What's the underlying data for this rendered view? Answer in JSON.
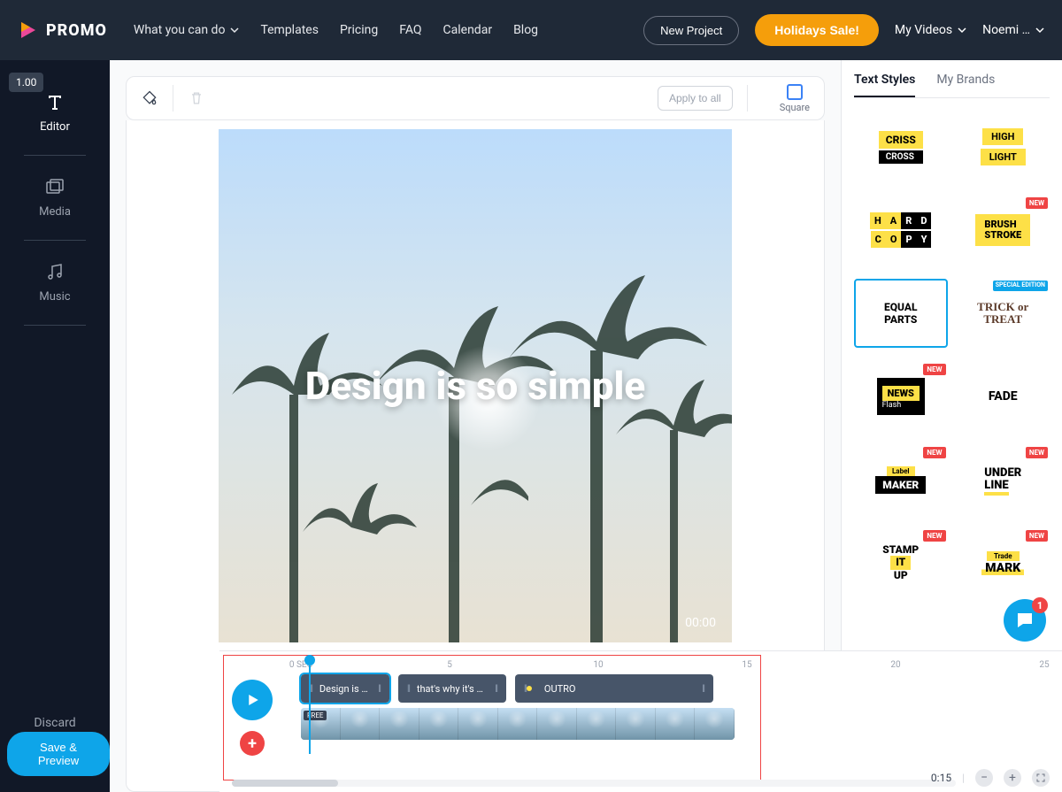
{
  "header": {
    "logo_text": "PROMO",
    "nav": [
      "What you can do",
      "Templates",
      "Pricing",
      "FAQ",
      "Calendar",
      "Blog"
    ],
    "new_project": "New Project",
    "holidays": "Holidays Sale!",
    "my_videos": "My Videos",
    "user": "Noemi …"
  },
  "sidebar": {
    "version": "1.00",
    "items": [
      {
        "label": "Editor"
      },
      {
        "label": "Media"
      },
      {
        "label": "Music"
      }
    ],
    "discard": "Discard",
    "save_preview": "Save & Preview"
  },
  "toolbar": {
    "apply_all": "Apply to all",
    "aspect_label": "Square"
  },
  "canvas": {
    "text": "Design is so simple",
    "time": "00:00"
  },
  "right": {
    "tabs": [
      "Text Styles",
      "My Brands"
    ],
    "styles": [
      {
        "id": "criss",
        "line1": "CRISS",
        "line2": "CROSS"
      },
      {
        "id": "highlight",
        "line1": "HIGH",
        "line2": "LIGHT"
      },
      {
        "id": "hardcopy",
        "top": "HARD",
        "bot": "COPY"
      },
      {
        "id": "brush",
        "line1": "BRUSH",
        "line2": "STROKE",
        "new": true
      },
      {
        "id": "equal",
        "line1": "EQUAL",
        "line2": "PARTS",
        "selected": true
      },
      {
        "id": "trick",
        "line1": "TRICK or",
        "line2": "TREAT",
        "special": "SPECIAL EDITION"
      },
      {
        "id": "news",
        "line1": "NEWS",
        "line2": "Flash",
        "new": true
      },
      {
        "id": "fade",
        "line1": "FADE"
      },
      {
        "id": "maker",
        "line1": "Label",
        "line2": "MAKER",
        "new": true
      },
      {
        "id": "under",
        "line1": "UNDER",
        "line2": "LINE",
        "new": true
      },
      {
        "id": "stamp",
        "line1": "STAMP",
        "line2": "IT",
        "line3": "UP",
        "new": true
      },
      {
        "id": "trade",
        "line1": "Trade",
        "line2": "MARK",
        "new": true
      }
    ]
  },
  "timeline": {
    "ruler_start": "0 SEC",
    "ticks": [
      "5",
      "10",
      "15",
      "20",
      "25"
    ],
    "clips": [
      {
        "label": "Design is …"
      },
      {
        "label": "that's why it's s…"
      },
      {
        "label": "OUTRO"
      }
    ],
    "free_badge": "FREE",
    "duration": "0:15"
  },
  "chat": {
    "badge": "1"
  }
}
